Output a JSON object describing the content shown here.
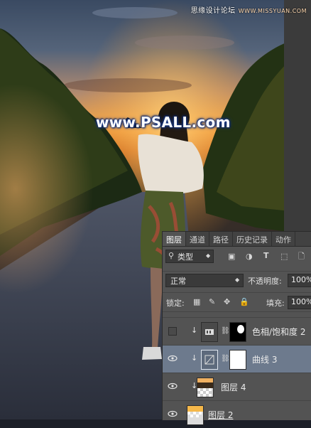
{
  "watermark": {
    "top_text": "思缘设计论坛",
    "top_site": "WWW.MISSYUAN.COM",
    "main": "www.PSALL.com"
  },
  "panel": {
    "tabs": [
      {
        "label": "图层",
        "active": true
      },
      {
        "label": "通道",
        "active": false
      },
      {
        "label": "路径",
        "active": false
      },
      {
        "label": "历史记录",
        "active": false
      },
      {
        "label": "动作",
        "active": false
      }
    ],
    "filter_label": "类型",
    "blend_mode": "正常",
    "opacity_label": "不透明度:",
    "opacity_value": "100%",
    "lock_label": "锁定:",
    "fill_label": "填充:",
    "fill_value": "100%",
    "layers": [
      {
        "name": "色相/饱和度 2",
        "visible": false,
        "clipped": true,
        "type": "adjustment-hue",
        "selected": false
      },
      {
        "name": "曲线 3",
        "visible": true,
        "clipped": true,
        "type": "adjustment-curves",
        "selected": true
      },
      {
        "name": "图层 4",
        "visible": true,
        "clipped": true,
        "type": "pixel",
        "selected": false
      },
      {
        "name": "图层 2",
        "visible": true,
        "clipped": false,
        "type": "pixel",
        "selected": false
      }
    ]
  },
  "colors": {
    "panel_bg": "#535353",
    "tab_bg": "#424242",
    "selected_row": "#6d7a8d",
    "watermark_glow": "#1a3a8a"
  }
}
